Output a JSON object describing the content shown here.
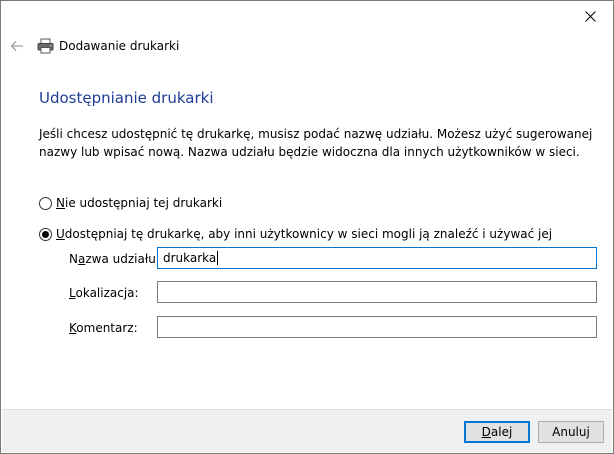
{
  "window": {
    "close_glyph": "✕"
  },
  "header": {
    "title": "Dodawanie drukarki",
    "back_icon": "back-arrow-icon",
    "printer_icon": "printer-icon"
  },
  "main": {
    "heading": "Udostępnianie drukarki",
    "description": "Jeśli chcesz udostępnić tę drukarkę, musisz podać nazwę udziału. Możesz użyć sugerowanej nazwy lub wpisać nową. Nazwa udziału będzie widoczna dla innych użytkowników w sieci.",
    "options": [
      {
        "label_access": "N",
        "label_rest": "ie udostępniaj tej drukarki",
        "selected": false
      },
      {
        "label_access": "U",
        "label_rest": "dostępniaj tę drukarkę, aby inni użytkownicy w sieci mogli ją znaleźć i używać jej",
        "selected": true
      }
    ],
    "fields": {
      "share_name": {
        "label_pre": "N",
        "label_access": "a",
        "label_post": "zwa udziału:",
        "value": "drukarka"
      },
      "location": {
        "label_pre": "",
        "label_access": "L",
        "label_post": "okalizacja:",
        "value": ""
      },
      "comment": {
        "label_pre": "",
        "label_access": "K",
        "label_post": "omentarz:",
        "value": ""
      }
    }
  },
  "footer": {
    "next_access": "D",
    "next_rest": "alej",
    "cancel": "Anuluj"
  },
  "colors": {
    "heading": "#1e3c96",
    "focus_border": "#0078d7",
    "footer_bg": "#f0f0f0"
  }
}
